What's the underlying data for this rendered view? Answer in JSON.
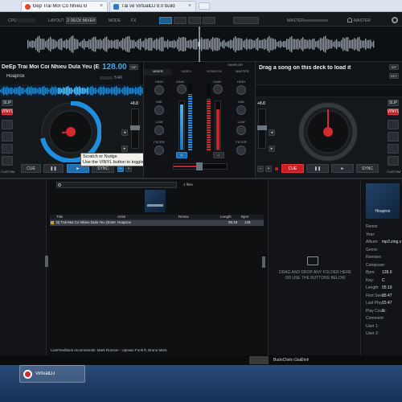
{
  "browser": {
    "tabs": [
      {
        "label": "Đẹp Trai Mới Có Nhiều Đ"
      },
      {
        "label": "Tải về VirtualDJ 8.0 build"
      }
    ],
    "accent": "#4a90d9"
  },
  "vdj": {
    "topbar": {
      "cpu": "CPU",
      "layout": "LAYOUT",
      "deck_mode": "2 DECK MIXER",
      "mode": "MODE",
      "fx": "FX",
      "master": "MASTER",
      "headphones": "MASTER"
    },
    "left_deck": {
      "title": "DeEp Trai Moi Coi Nhieu Dula Yeu (Exte",
      "bpm": "128.00",
      "artist": "Hoaprox",
      "time": "5:40",
      "pitch": "+0.0",
      "buttons": {
        "slip": "SLIP",
        "vinyl": "VINYL",
        "custom": "CUSTOM",
        "cue": "CUE",
        "play": "►",
        "sync": "SYNC"
      },
      "tooltip_line1": "Scratch or Nudge",
      "tooltip_line2": "Use the VINYL button to toggle mode"
    },
    "right_deck": {
      "title": "Drag a song on this deck to load it",
      "pitch": "+0.0",
      "buttons": {
        "slip": "SLIP",
        "vinyl": "VINYL",
        "custom": "CUSTOM",
        "cue": "CUE",
        "play": "►",
        "sync": "SYNC"
      }
    },
    "mixer": {
      "tabs": [
        {
          "label": "MIXER"
        },
        {
          "label": "VIDEO"
        },
        {
          "label": "SCRATCH"
        },
        {
          "label": "MASTER"
        }
      ],
      "sampler": "SAMPLER",
      "knobs_left": [
        "HIGH",
        "MID",
        "LOW",
        "FILTER"
      ],
      "knobs_right": [
        "HIGH",
        "MID",
        "LOW",
        "FILTER"
      ],
      "gain": "GAIN"
    },
    "browser": {
      "count": "1 files",
      "columns": [
        "Title",
        "Artist",
        "Remix",
        "Length",
        "Bpm"
      ],
      "rows": [
        {
          "title": "Dj Trai Moi Co Nhieu Dula Yeu (Extended Mix)",
          "artist": "Hoaprox",
          "remix": "",
          "length": "05:19",
          "bpm": "128"
        }
      ],
      "drop_line1": "DRAG AND DROP ANY FOLDER HERE",
      "drop_line2": "OR USE THE BUTTONS BELOW",
      "livefeedback": "LiveFeedback recommends: Mark Ronson - Uptown Funk ft. Bruno Mars"
    },
    "info": {
      "thumb_text": "Hoaprox",
      "fields": [
        {
          "label": "Remix:",
          "value": ""
        },
        {
          "label": "Year:",
          "value": ""
        },
        {
          "label": "Album:",
          "value": "mp3.zing.v"
        },
        {
          "label": "Genre:",
          "value": ""
        },
        {
          "label": "Remixer:",
          "value": ""
        },
        {
          "label": "Composer:",
          "value": ""
        },
        {
          "label": "Bpm:",
          "value": "128.0"
        },
        {
          "label": "Key:",
          "value": "C"
        },
        {
          "label": "Length:",
          "value": "05:19"
        },
        {
          "label": "First Seen:",
          "value": "15:47"
        },
        {
          "label": "Last Play:",
          "value": "15:47"
        },
        {
          "label": "Play Count:",
          "value": "1"
        },
        {
          "label": "Comment:",
          "value": ""
        },
        {
          "label": "User 1:",
          "value": ""
        },
        {
          "label": "User 2:",
          "value": ""
        }
      ]
    }
  },
  "taskbar": {
    "app": "VirtualDJ",
    "notif": "BuồnChiến GiaĐình"
  }
}
